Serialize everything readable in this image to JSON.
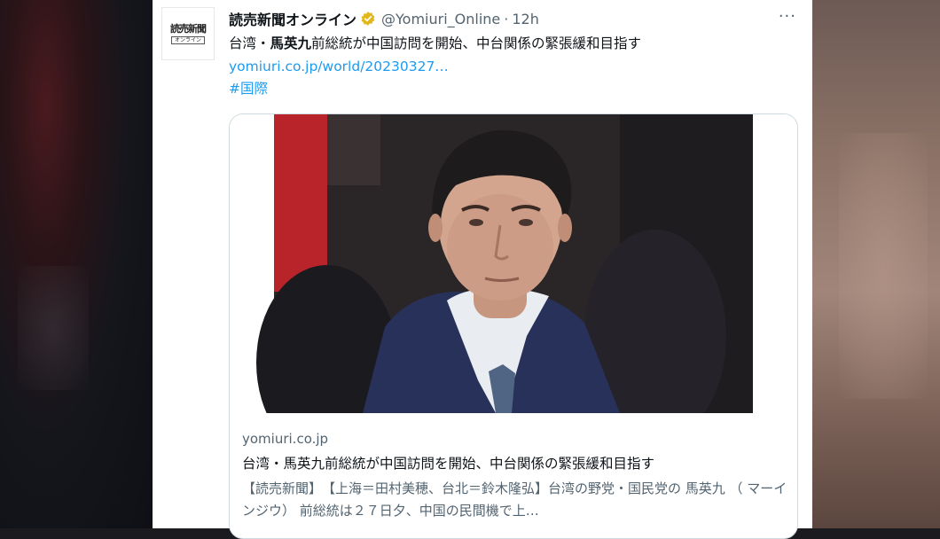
{
  "account": {
    "avatar_logo_text": "読売新聞",
    "avatar_logo_sub": "オンライン",
    "display_name": "読売新聞オンライン",
    "handle": "@Yomiuri_Online",
    "separator": "·",
    "time_ago": "12h",
    "verified": true
  },
  "tweet": {
    "text_before": "台湾・",
    "text_bold": "馬英九",
    "text_after": "前総統が中国訪問を開始、中台関係の緊張緩和目指す",
    "link": "yomiuri.co.jp/world/20230327…",
    "hashtag": "#国際",
    "more_label": "···"
  },
  "card": {
    "image_icon": "news-photo",
    "domain": "yomiuri.co.jp",
    "title": "台湾・馬英九前総統が中国訪問を開始、中台関係の緊張緩和目指す",
    "description": "【読売新聞】　【上海＝田村美穂、台北＝鈴木隆弘】台湾の野党・国民党の 馬英九 （ マーインジウ） 前総統は２７日夕、中国の民間機で上…"
  },
  "colors": {
    "link": "#1d9bf0",
    "secondary_text": "#536471",
    "primary_text": "#0f1419",
    "verified_badge": "#e2b719",
    "card_border": "#cfd9de"
  }
}
